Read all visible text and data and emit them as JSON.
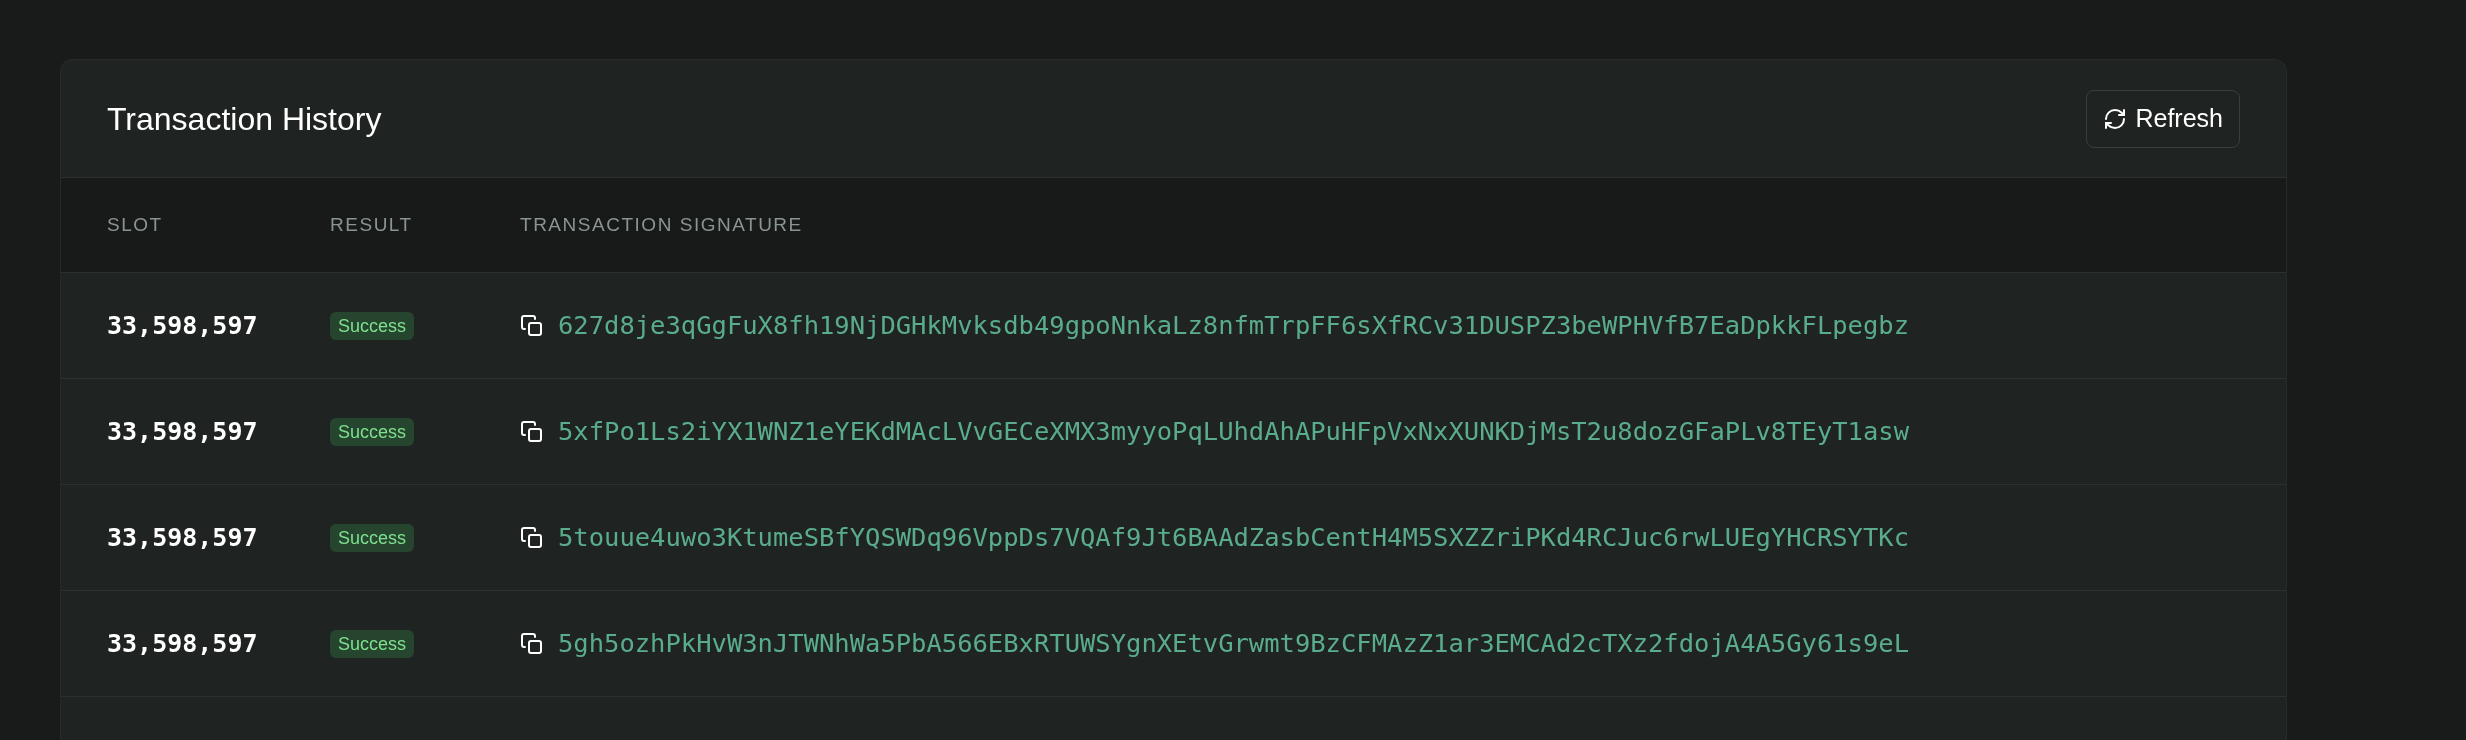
{
  "card": {
    "title": "Transaction History",
    "refresh_button": "Refresh"
  },
  "table": {
    "columns": [
      "SLOT",
      "RESULT",
      "TRANSACTION SIGNATURE"
    ],
    "rows": [
      {
        "slot": "33,598,597",
        "result": "Success",
        "signature": "627d8je3qGgFuX8fh19NjDGHkMvksdb49gpoNnkaLz8nfmTrpFF6sXfRCv31DUSPZ3beWPHVfB7EaDpkkFLpegbz"
      },
      {
        "slot": "33,598,597",
        "result": "Success",
        "signature": "5xfPo1Ls2iYX1WNZ1eYEKdMAcLVvGECeXMX3myyoPqLUhdAhAPuHFpVxNxXUNKDjMsT2u8dozGFaPLv8TEyT1asw"
      },
      {
        "slot": "33,598,597",
        "result": "Success",
        "signature": "5touue4uwo3KtumeSBfYQSWDq96VppDs7VQAf9Jt6BAAdZasbCentH4M5SXZZriPKd4RCJuc6rwLUEgYHCRSYTKc"
      },
      {
        "slot": "33,598,597",
        "result": "Success",
        "signature": "5gh5ozhPkHvW3nJTWNhWa5PbA566EBxRTUWSYgnXEtvGrwmt9BzCFMAzZ1ar3EMCAd2cTXz2fdojA4A5Gy61s9eL"
      }
    ]
  }
}
